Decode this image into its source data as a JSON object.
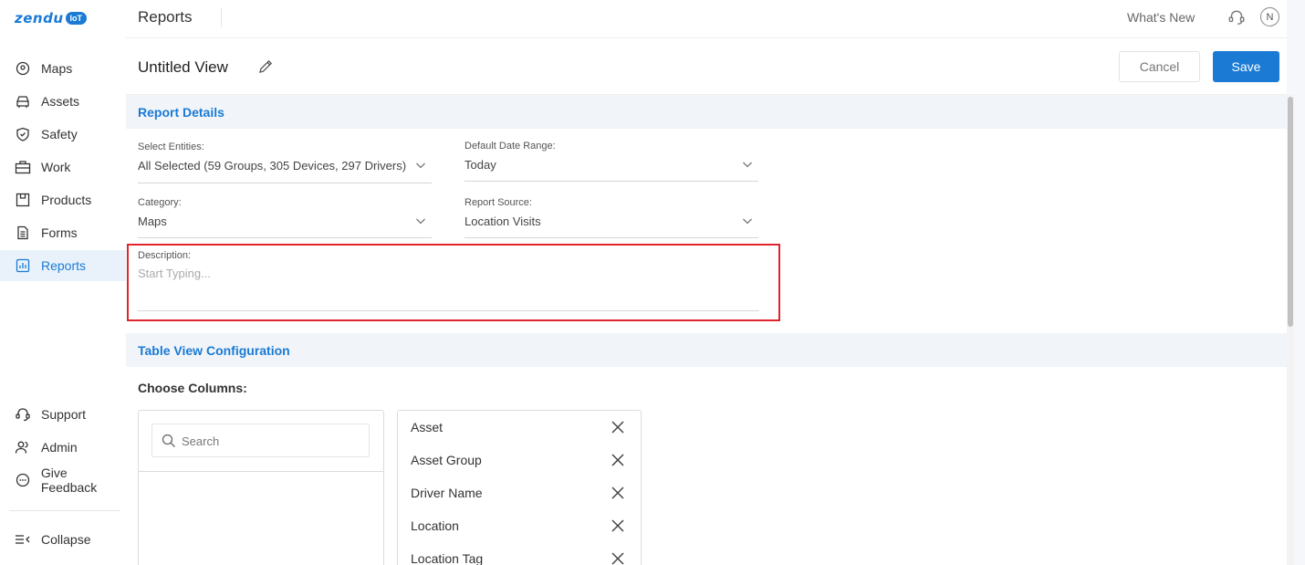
{
  "brand": {
    "logo_text": "zendu",
    "logo_badge": "IoT"
  },
  "sidebar": {
    "items": [
      {
        "label": "Maps",
        "icon": "map-pin-icon"
      },
      {
        "label": "Assets",
        "icon": "car-icon"
      },
      {
        "label": "Safety",
        "icon": "shield-icon"
      },
      {
        "label": "Work",
        "icon": "briefcase-icon"
      },
      {
        "label": "Products",
        "icon": "package-icon"
      },
      {
        "label": "Forms",
        "icon": "document-icon"
      },
      {
        "label": "Reports",
        "icon": "bar-chart-icon",
        "active": true
      }
    ],
    "bottom_items": [
      {
        "label": "Support",
        "icon": "headset-icon"
      },
      {
        "label": "Admin",
        "icon": "users-icon"
      },
      {
        "label": "Give Feedback",
        "icon": "chat-icon"
      }
    ],
    "collapse_label": "Collapse"
  },
  "topbar": {
    "title": "Reports",
    "whats_new": "What's New",
    "avatar_initial": "N"
  },
  "header": {
    "view_title": "Untitled View",
    "cancel_label": "Cancel",
    "save_label": "Save"
  },
  "report_details": {
    "heading": "Report Details",
    "select_entities": {
      "label": "Select Entities:",
      "value": "All Selected (59 Groups, 305 Devices, 297 Drivers)"
    },
    "default_date_range": {
      "label": "Default Date Range:",
      "value": "Today"
    },
    "category": {
      "label": "Category:",
      "value": "Maps"
    },
    "report_source": {
      "label": "Report Source:",
      "value": "Location Visits"
    },
    "description": {
      "label": "Description:",
      "placeholder": "Start Typing..."
    }
  },
  "table_view": {
    "heading": "Table View Configuration",
    "choose_columns_label": "Choose Columns:",
    "search_placeholder": "Search",
    "selected_columns": [
      "Asset",
      "Asset Group",
      "Driver Name",
      "Location",
      "Location Tag"
    ]
  },
  "colors": {
    "accent": "#1a7ad4",
    "highlight": "#e0242b"
  }
}
